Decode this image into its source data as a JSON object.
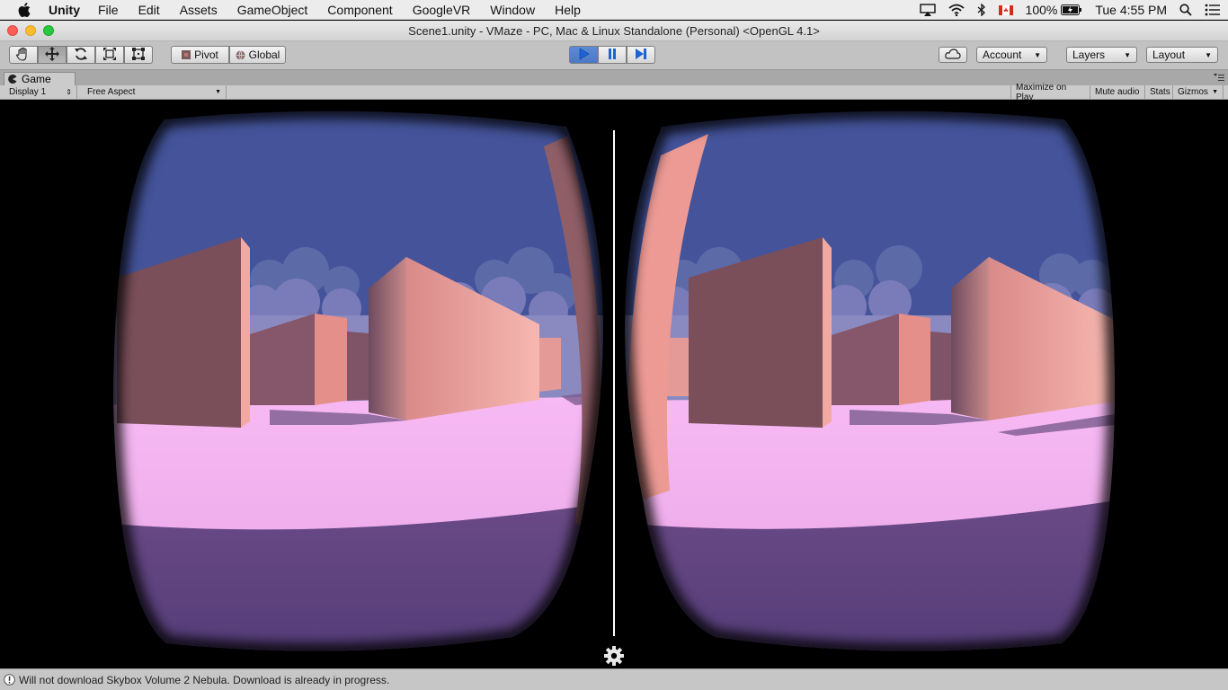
{
  "menubar": {
    "items": [
      "Unity",
      "File",
      "Edit",
      "Assets",
      "GameObject",
      "Component",
      "GoogleVR",
      "Window",
      "Help"
    ],
    "battery": "100%",
    "clock": "Tue 4:55 PM"
  },
  "window": {
    "title": "Scene1.unity - VMaze - PC, Mac & Linux Standalone (Personal) <OpenGL 4.1>"
  },
  "toolbar": {
    "pivot_label": "Pivot",
    "global_label": "Global",
    "account_label": "Account",
    "layers_label": "Layers",
    "layout_label": "Layout"
  },
  "game_panel": {
    "tab_label": "Game",
    "display": "Display 1",
    "aspect": "Free Aspect",
    "maximize_on_play": "Maximize on Play",
    "mute_audio": "Mute audio",
    "stats": "Stats",
    "gizmos": "Gizmos"
  },
  "status": {
    "message": "Will not download Skybox Volume 2 Nebula. Download is already in progress."
  },
  "colors": {
    "sky": "#44539a",
    "floor": "#f6b8f2",
    "wall_dark": "#7a4f5a",
    "wall_light": "#e5928f",
    "play_accent": "#4b79c3"
  }
}
